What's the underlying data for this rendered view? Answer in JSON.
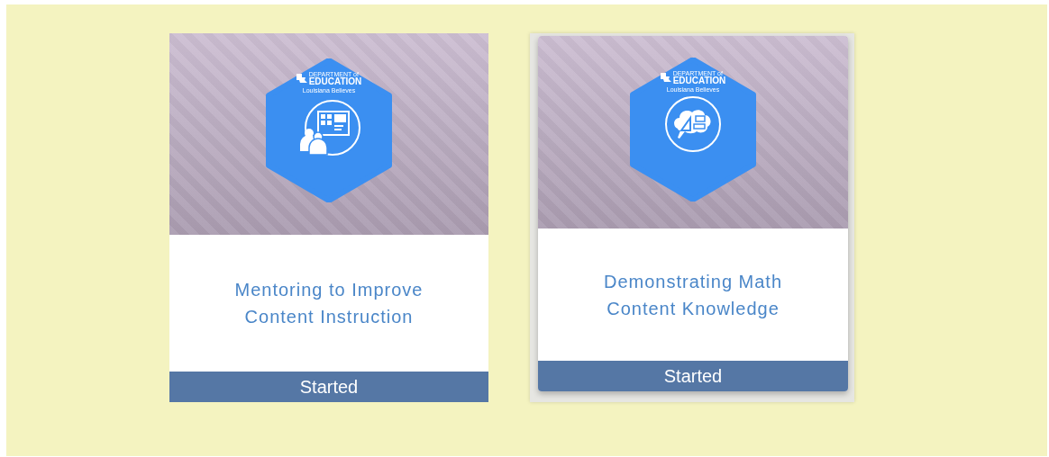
{
  "cards": [
    {
      "title": "Mentoring to Improve Content Instruction",
      "status": "Started",
      "hovered": false,
      "badge": {
        "kind": "presentation",
        "org_line_1": "DEPARTMENT of",
        "org_line_2": "EDUCATION",
        "tagline": "Louisiana Believes"
      }
    },
    {
      "title": "Demonstrating Math Content Knowledge",
      "status": "Started",
      "hovered": true,
      "badge": {
        "kind": "math",
        "org_line_1": "DEPARTMENT of",
        "org_line_2": "EDUCATION",
        "tagline": "Louisiana Believes"
      }
    }
  ]
}
